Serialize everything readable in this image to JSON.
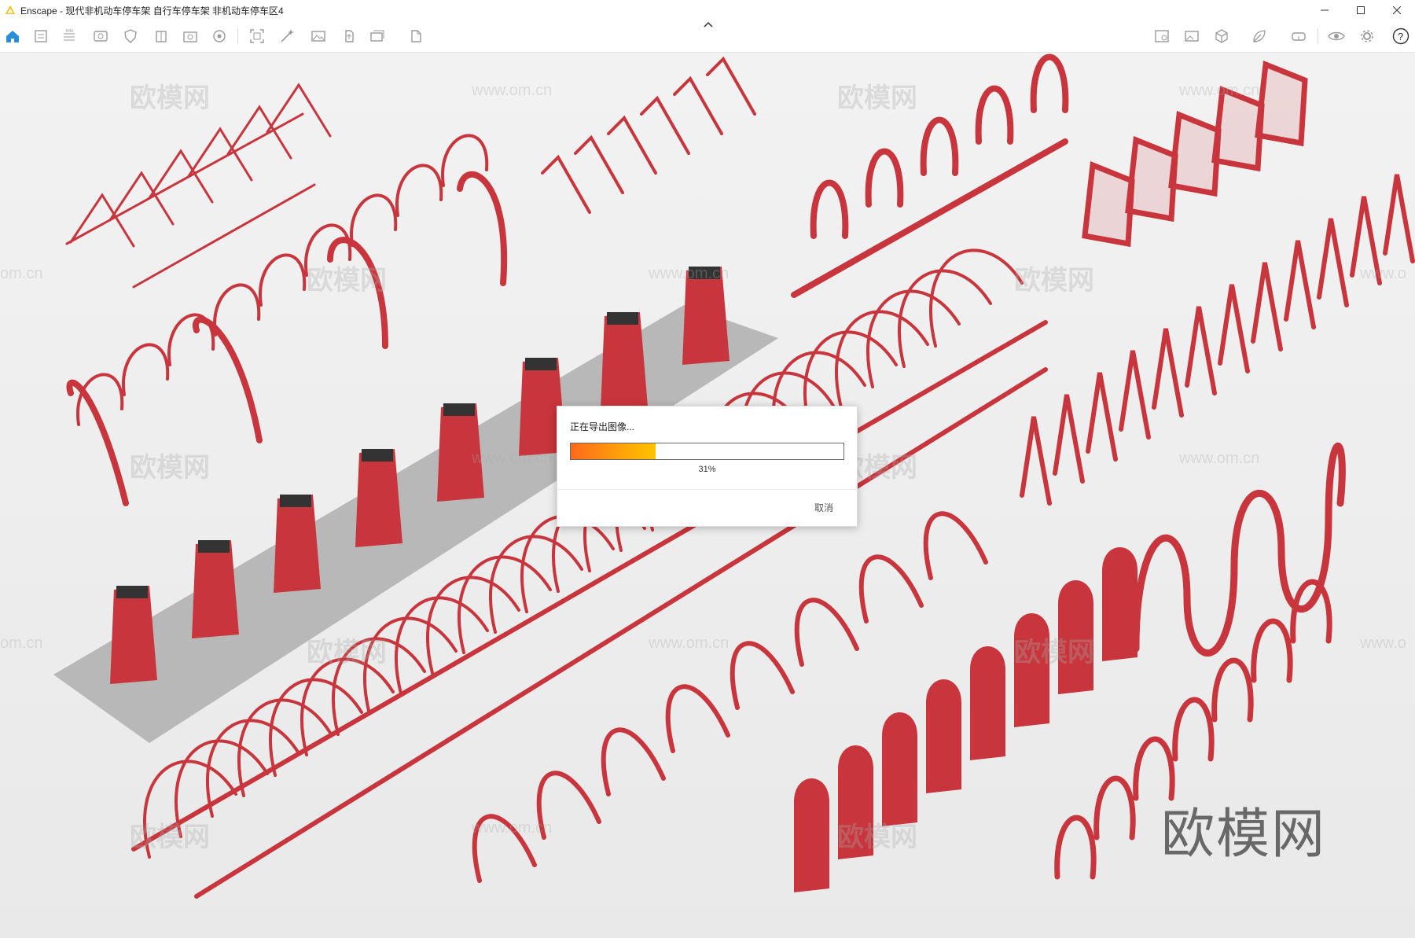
{
  "window": {
    "app_name": "Enscape",
    "title_separator": "-",
    "document_title": "现代非机动车停车架 自行车停车架 非机动车停车区4",
    "controls": {
      "minimize_icon": "minimize-icon",
      "maximize_icon": "maximize-icon",
      "close_icon": "close-icon"
    }
  },
  "toolbar": {
    "left_icons": [
      "home-icon",
      "document-icon",
      "bim-icon",
      "render-window-icon",
      "shield-icon",
      "building-icon",
      "camera-icon",
      "asset-library-icon",
      "screenshot-icon",
      "magic-wand-icon",
      "image-icon",
      "upload-icon",
      "batch-icon",
      "export-icon"
    ],
    "right_icons": [
      "map-icon",
      "gallery-icon",
      "cube-icon",
      "leaf-icon",
      "vr-headset-icon",
      "eye-icon",
      "settings-icon",
      "help-icon"
    ],
    "accent_color": "#2a8fd6"
  },
  "viewport": {
    "watermark_text": "欧模网",
    "watermark_url": "www.om.cn",
    "watermark_url_partial": "om.cn",
    "watermark_url_edge": "www.o",
    "brand_text": "欧模网",
    "rack_color": "#c8353c"
  },
  "export_dialog": {
    "title": "正在导出图像...",
    "progress": 0.31,
    "percent_label": "31%",
    "cancel_label": "取消"
  }
}
